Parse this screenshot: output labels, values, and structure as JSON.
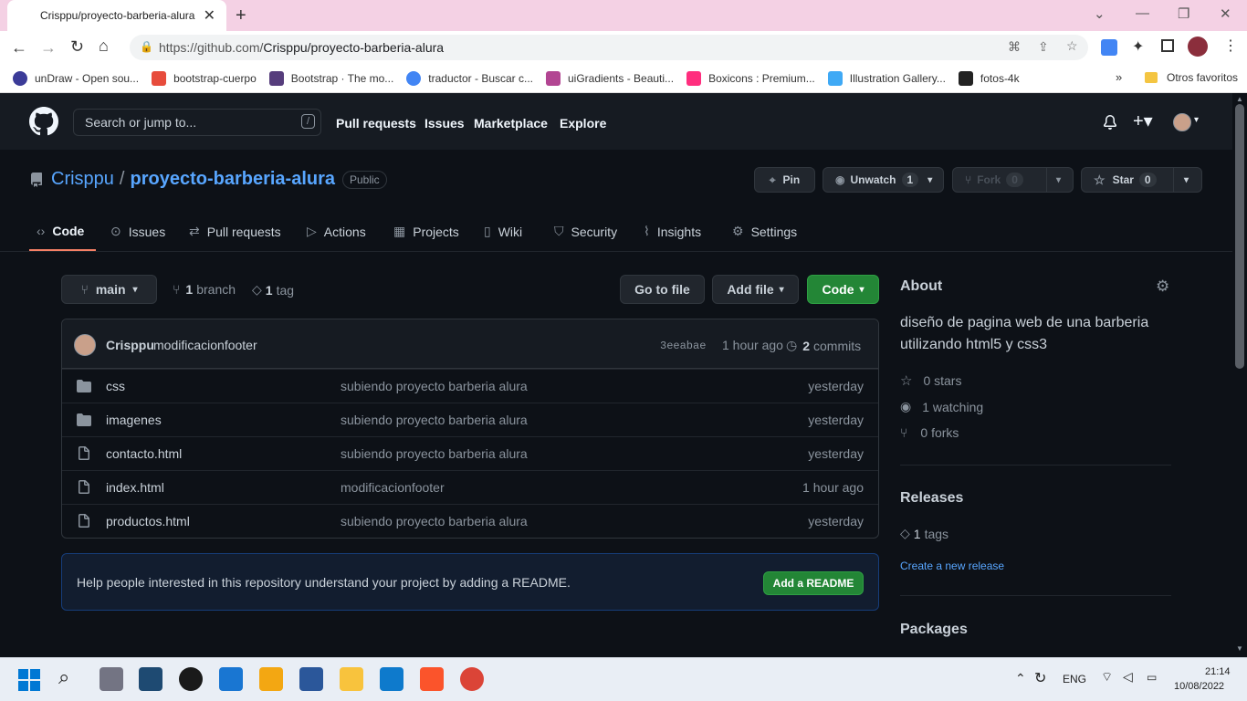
{
  "browser": {
    "tab_title": "Crisppu/proyecto-barberia-alura",
    "url_host": "https://github.com/",
    "url_path": "Crisppu/proyecto-barberia-alura",
    "bookmarks": [
      {
        "label": "unDraw - Open sou...",
        "color": "#3b3b98"
      },
      {
        "label": "bootstrap-cuerpo",
        "color": "#e74c3c"
      },
      {
        "label": "Bootstrap · The mo...",
        "color": "#563d7c"
      },
      {
        "label": "traductor - Buscar c...",
        "color": "#4285f4"
      },
      {
        "label": "uiGradients - Beauti...",
        "color": "#b24592"
      },
      {
        "label": "Boxicons : Premium...",
        "color": "#ff2e7e"
      },
      {
        "label": "Illustration Gallery...",
        "color": "#3fa9f5"
      },
      {
        "label": "fotos-4k",
        "color": "#222222"
      }
    ],
    "other_favorites": "Otros favoritos"
  },
  "gh_header": {
    "search_placeholder": "Search or jump to...",
    "search_key": "/",
    "nav": [
      "Pull requests",
      "Issues",
      "Marketplace",
      "Explore"
    ]
  },
  "repo": {
    "owner": "Crisppu",
    "name": "proyecto-barberia-alura",
    "visibility": "Public",
    "pin": "Pin",
    "unwatch": "Unwatch",
    "watch_count": "1",
    "fork": "Fork",
    "fork_count": "0",
    "star": "Star",
    "star_count": "0",
    "tabs": [
      "Code",
      "Issues",
      "Pull requests",
      "Actions",
      "Projects",
      "Wiki",
      "Security",
      "Insights",
      "Settings"
    ]
  },
  "branchbar": {
    "branch": "main",
    "branch_count": "1",
    "branch_label": "branch",
    "tag_count": "1",
    "tag_label": "tag",
    "go_to_file": "Go to file",
    "add_file": "Add file",
    "code": "Code"
  },
  "commit": {
    "author": "Crisppu",
    "message": "modificacionfooter",
    "sha": "3eeabae",
    "time": "1 hour ago",
    "commit_count": "2",
    "commit_label": "commits"
  },
  "files": [
    {
      "name": "css",
      "type": "dir",
      "msg": "subiendo proyecto barberia alura",
      "age": "yesterday"
    },
    {
      "name": "imagenes",
      "type": "dir",
      "msg": "subiendo proyecto barberia alura",
      "age": "yesterday"
    },
    {
      "name": "contacto.html",
      "type": "file",
      "msg": "subiendo proyecto barberia alura",
      "age": "yesterday"
    },
    {
      "name": "index.html",
      "type": "file",
      "msg": "modificacionfooter",
      "age": "1 hour ago"
    },
    {
      "name": "productos.html",
      "type": "file",
      "msg": "subiendo proyecto barberia alura",
      "age": "yesterday"
    }
  ],
  "readme": {
    "text": "Help people interested in this repository understand your project by adding a README.",
    "button": "Add a README"
  },
  "about": {
    "title": "About",
    "description": "diseño de pagina web de una barberia utilizando html5 y css3",
    "stars": "0 stars",
    "watching": "1 watching",
    "forks": "0 forks",
    "releases_title": "Releases",
    "tags_count": "1",
    "tags_label": "tags",
    "create_release": "Create a new release",
    "packages_title": "Packages"
  },
  "taskbar": {
    "lang": "ENG",
    "time": "21:14",
    "date": "10/08/2022"
  }
}
